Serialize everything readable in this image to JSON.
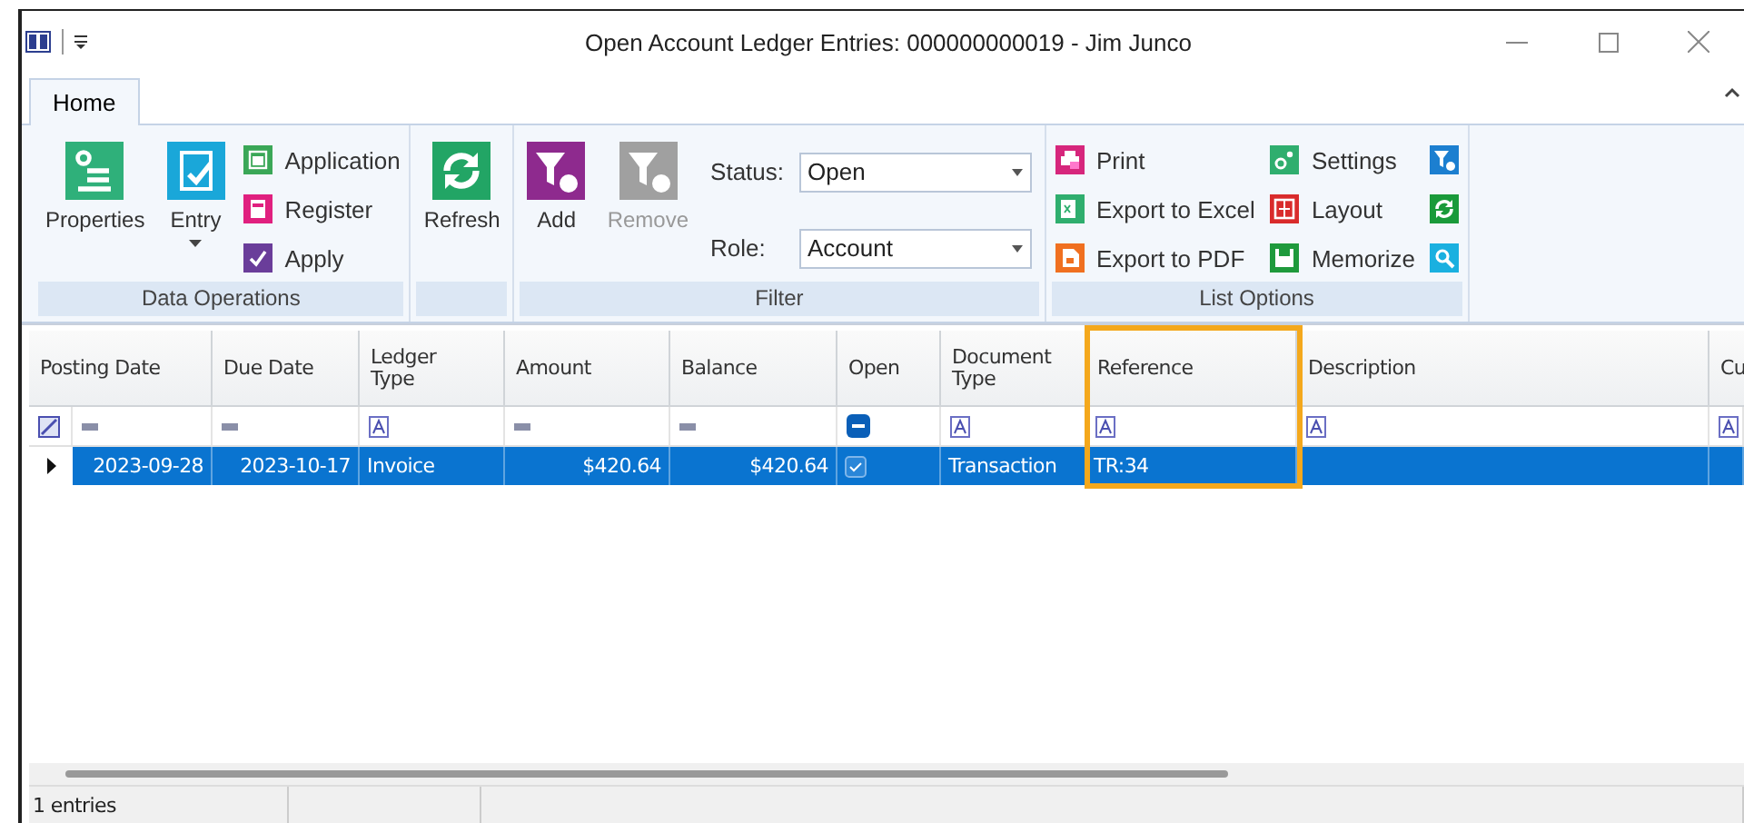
{
  "window": {
    "title": "Open Account Ledger Entries: 000000000019 - Jim Junco"
  },
  "tabs": [
    {
      "label": "Home",
      "selected": true
    }
  ],
  "ribbon": [
    {
      "caption": "Data Operations",
      "items": [
        {
          "kind": "large",
          "label": "Properties",
          "disabled": false
        },
        {
          "kind": "split",
          "label": "Entry",
          "disabled": false
        },
        {
          "kind": "stack",
          "items": [
            {
              "kind": "small",
              "label": "Application",
              "disabled": false
            },
            {
              "kind": "small",
              "label": "Register",
              "disabled": false
            },
            {
              "kind": "small",
              "label": "Apply",
              "disabled": false
            }
          ]
        }
      ]
    },
    {
      "items": [
        {
          "kind": "large",
          "label": "Refresh",
          "disabled": false
        }
      ]
    },
    {
      "caption": "Filter",
      "items": [
        {
          "kind": "large",
          "label": "Add",
          "disabled": false
        },
        {
          "kind": "large",
          "label": "Remove",
          "disabled": true
        },
        {
          "kind": "fields",
          "fields": [
            {
              "label": "Status:",
              "value": "Open"
            },
            {
              "label": "Role:",
              "value": "Account"
            }
          ]
        }
      ]
    },
    {
      "caption": "List Options",
      "items": [
        {
          "kind": "stack",
          "items": [
            {
              "kind": "small",
              "label": "Print",
              "disabled": false
            },
            {
              "kind": "small",
              "label": "Export to Excel",
              "disabled": false
            },
            {
              "kind": "small",
              "label": "Export to PDF",
              "disabled": false
            }
          ]
        },
        {
          "kind": "stack",
          "items": [
            {
              "kind": "small",
              "label": "Settings",
              "disabled": false
            },
            {
              "kind": "small",
              "label": "Layout",
              "disabled": false
            },
            {
              "kind": "small",
              "label": "Memorize",
              "disabled": false
            }
          ]
        },
        {
          "kind": "stack",
          "items": [
            {
              "kind": "icon",
              "disabled": false
            },
            {
              "kind": "icon",
              "disabled": false
            },
            {
              "kind": "icon",
              "disabled": false
            }
          ]
        }
      ]
    }
  ],
  "table": {
    "columns": [
      {
        "label": "Posting Date",
        "kind": "number",
        "highlighted": false
      },
      {
        "label": "Due Date",
        "kind": "number",
        "highlighted": false
      },
      {
        "label": "Ledger Type",
        "kind": "text",
        "highlighted": false
      },
      {
        "label": "Amount",
        "kind": "number",
        "highlighted": false
      },
      {
        "label": "Balance",
        "kind": "number",
        "highlighted": false
      },
      {
        "label": "Open",
        "kind": "check",
        "highlighted": false
      },
      {
        "label": "Document Type",
        "kind": "text",
        "highlighted": false
      },
      {
        "label": "Reference",
        "kind": "text",
        "highlighted": true
      },
      {
        "label": "Description",
        "kind": "text",
        "highlighted": false
      },
      {
        "label": "Cu",
        "kind": "text",
        "highlighted": false
      }
    ],
    "rows": [
      {
        "selected": true,
        "current": true,
        "cells": [
          {
            "text": "2023-09-28"
          },
          {
            "text": "2023-10-17"
          },
          {
            "text": "Invoice"
          },
          {
            "text": "$420.64"
          },
          {
            "text": "$420.64"
          },
          {
            "checked": true
          },
          {
            "text": "Transaction"
          },
          {
            "text": "TR:34"
          },
          {},
          {}
        ]
      }
    ]
  },
  "status_bar": {
    "text": "1 entries"
  }
}
